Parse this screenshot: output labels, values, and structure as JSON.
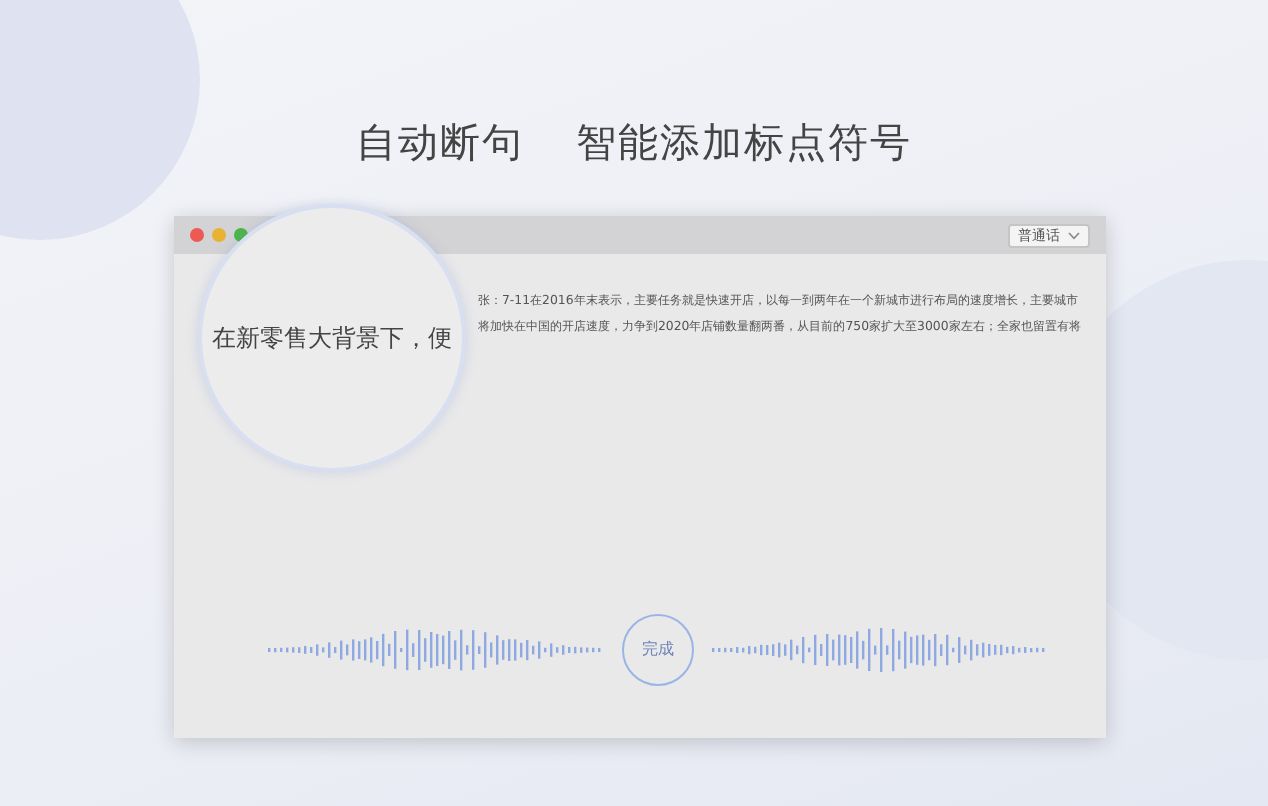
{
  "headline": {
    "left": "自动断句",
    "right": "智能添加标点符号"
  },
  "window": {
    "language_dropdown": "普通话",
    "transcript_lines": [
      "张：7-11在2016年末表示，主要任务就是快速开店，以每一到两年在一个新城市进行布局的速度增长，主要城市",
      "将加快在中国的开店速度，力争到2020年店铺数量翻两番，从目前的750家扩大至3000家左右；全家也留置有将"
    ],
    "magnifier_text": "在新零售大背景下，便",
    "done_button": "完成"
  }
}
